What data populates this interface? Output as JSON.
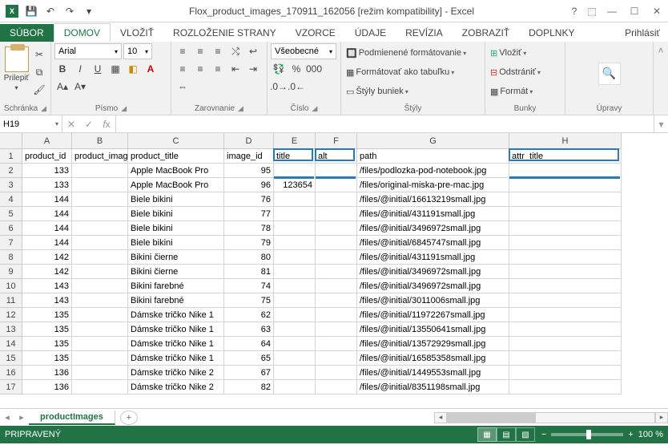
{
  "titlebar": {
    "title": "Flox_product_images_170911_162056  [režim kompatibility] - Excel"
  },
  "tabs": {
    "file": "SÚBOR",
    "items": [
      "DOMOV",
      "VLOŽIŤ",
      "ROZLOŽENIE STRANY",
      "VZORCE",
      "ÚDAJE",
      "REVÍZIA",
      "ZOBRAZIŤ",
      "DOPLNKY"
    ],
    "active": 0,
    "login": "Prihlásiť"
  },
  "ribbon": {
    "clipboard": {
      "paste": "Prilepiť",
      "label": "Schránka"
    },
    "font": {
      "name": "Arial",
      "size": "10",
      "label": "Písmo"
    },
    "align": {
      "label": "Zarovnanie"
    },
    "number": {
      "format": "Všeobecné",
      "label": "Číslo"
    },
    "styles": {
      "cond": "Podmienené formátovanie",
      "table": "Formátovať ako tabuľku",
      "cell": "Štýly buniek",
      "label": "Štýly"
    },
    "cells": {
      "insert": "Vložiť",
      "delete": "Odstrániť",
      "format": "Formát",
      "label": "Bunky"
    },
    "edit": {
      "label": "Úpravy"
    }
  },
  "namebox": "H19",
  "columns": [
    {
      "l": "A",
      "w": 62
    },
    {
      "l": "B",
      "w": 70
    },
    {
      "l": "C",
      "w": 120
    },
    {
      "l": "D",
      "w": 62
    },
    {
      "l": "E",
      "w": 52
    },
    {
      "l": "F",
      "w": 52
    },
    {
      "l": "G",
      "w": 190
    },
    {
      "l": "H",
      "w": 140
    }
  ],
  "header_row": [
    "product_id",
    "product_image_id",
    "product_title",
    "image_id",
    "title",
    "alt",
    "path",
    "attr_title"
  ],
  "rows": [
    [
      "133",
      "",
      "Apple MacBook Pro",
      "95",
      "",
      "",
      "/files/podlozka-pod-notebook.jpg",
      ""
    ],
    [
      "133",
      "",
      "Apple MacBook Pro",
      "96",
      "123654",
      "",
      "/files/original-miska-pre-mac.jpg",
      ""
    ],
    [
      "144",
      "",
      "Biele bikini",
      "76",
      "",
      "",
      "/files/@initial/16613219small.jpg",
      ""
    ],
    [
      "144",
      "",
      "Biele bikini",
      "77",
      "",
      "",
      "/files/@initial/431191small.jpg",
      ""
    ],
    [
      "144",
      "",
      "Biele bikini",
      "78",
      "",
      "",
      "/files/@initial/3496972small.jpg",
      ""
    ],
    [
      "144",
      "",
      "Biele bikini",
      "79",
      "",
      "",
      "/files/@initial/6845747small.jpg",
      ""
    ],
    [
      "142",
      "",
      "Bikini čierne",
      "80",
      "",
      "",
      "/files/@initial/431191small.jpg",
      ""
    ],
    [
      "142",
      "",
      "Bikini čierne",
      "81",
      "",
      "",
      "/files/@initial/3496972small.jpg",
      ""
    ],
    [
      "143",
      "",
      "Bikini farebné",
      "74",
      "",
      "",
      "/files/@initial/3496972small.jpg",
      ""
    ],
    [
      "143",
      "",
      "Bikini farebné",
      "75",
      "",
      "",
      "/files/@initial/3011006small.jpg",
      ""
    ],
    [
      "135",
      "",
      "Dámske tričko Nike 1",
      "62",
      "",
      "",
      "/files/@initial/11972267small.jpg",
      ""
    ],
    [
      "135",
      "",
      "Dámske tričko Nike 1",
      "63",
      "",
      "",
      "/files/@initial/13550641small.jpg",
      ""
    ],
    [
      "135",
      "",
      "Dámske tričko Nike 1",
      "64",
      "",
      "",
      "/files/@initial/13572929small.jpg",
      ""
    ],
    [
      "135",
      "",
      "Dámske tričko Nike 1",
      "65",
      "",
      "",
      "/files/@initial/16585358small.jpg",
      ""
    ],
    [
      "136",
      "",
      "Dámske tričko Nike 2",
      "67",
      "",
      "",
      "/files/@initial/1449553small.jpg",
      ""
    ],
    [
      "136",
      "",
      "Dámske tričko Nike 2",
      "82",
      "",
      "",
      "/files/@initial/8351198small.jpg",
      ""
    ]
  ],
  "numeric_cols": [
    0,
    3,
    4
  ],
  "highlights": [
    {
      "row": 0,
      "col": 4
    },
    {
      "row": 0,
      "col": 5
    },
    {
      "row": 0,
      "col": 7
    },
    {
      "row": 1,
      "col": 4,
      "under": true
    },
    {
      "row": 1,
      "col": 5,
      "under": true
    },
    {
      "row": 1,
      "col": 7,
      "under": true
    }
  ],
  "sheet": {
    "name": "productImages"
  },
  "status": {
    "ready": "PRIPRAVENÝ",
    "zoom": "100 %"
  }
}
